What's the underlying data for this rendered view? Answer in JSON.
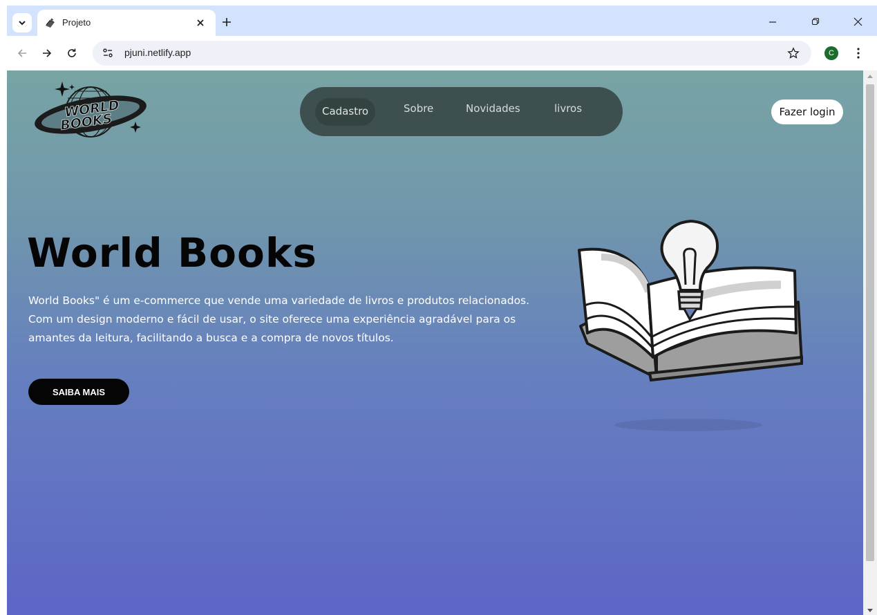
{
  "browser": {
    "tab_title": "Projeto",
    "url": "pjuni.netlify.app",
    "profile_initial": "C"
  },
  "site": {
    "nav": [
      "Cadastro",
      "Sobre",
      "Novidades",
      "livros"
    ],
    "login_label": "Fazer login",
    "hero_title": "World Books",
    "hero_text": "World Books\" é um e-commerce que vende uma variedade de livros e produtos relacionados. Com um design moderno e fácil de usar, o site oferece uma experiência agradável para os amantes da leitura, facilitando a busca e a compra de novos títulos.",
    "cta_label": "SAIBA MAIS",
    "logo_text": [
      "WORLD",
      "BOOKS"
    ]
  },
  "colors": {
    "gradient_top": "#78a4a4",
    "gradient_bottom": "#5d65c6",
    "nav_pill": "#3d504f",
    "cta": "#050505"
  }
}
